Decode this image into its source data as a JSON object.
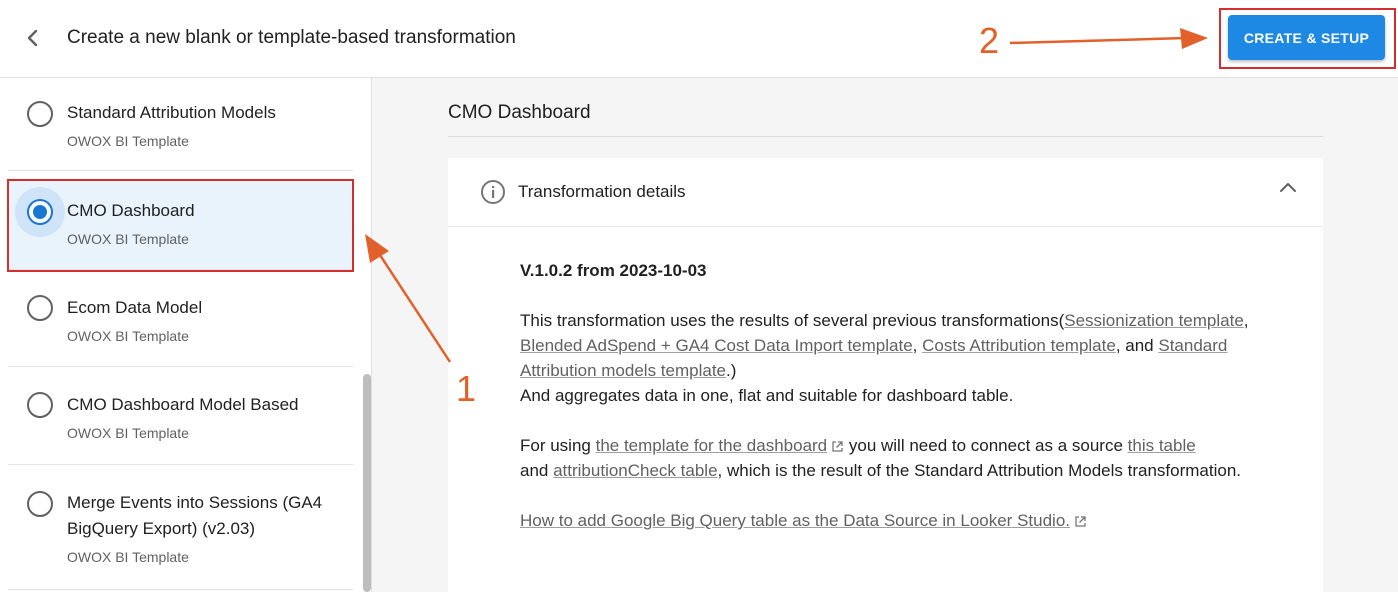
{
  "header": {
    "title": "Create a new blank or template-based transformation",
    "cta_label": "CREATE & SETUP"
  },
  "sidebar": {
    "items": [
      {
        "name": "Standard Attribution Models",
        "sub": "OWOX BI Template",
        "selected": false
      },
      {
        "name": "CMO Dashboard",
        "sub": "OWOX BI Template",
        "selected": true
      },
      {
        "name": "Ecom Data Model",
        "sub": "OWOX BI Template",
        "selected": false
      },
      {
        "name": "CMO Dashboard Model Based",
        "sub": "OWOX BI Template",
        "selected": false
      },
      {
        "name_line1": "Merge Events into Sessions (GA4",
        "name_line2": "BigQuery Export) (v2.03)",
        "sub": "OWOX BI Template",
        "selected": false
      }
    ]
  },
  "main": {
    "title": "CMO Dashboard",
    "details_title": "Transformation details",
    "version": "V.1.0.2 from 2023-10-03",
    "para1": {
      "t1": "This transformation uses the results of several previous transformations(",
      "l1": "Sessionization template",
      "t2": ", ",
      "l2": "Blended AdSpend + GA4 Cost Data Import template",
      "t3": ", ",
      "l3": "Costs Attribution template",
      "t4": ", and ",
      "l4": "Standard Attribution models template",
      "t5": ".)",
      "t6": "And aggregates data in one, flat and suitable for dashboard table."
    },
    "para2": {
      "t1": "For using ",
      "l1": "the template for the dashboard",
      "t2": "  you will need to connect as a source ",
      "l2": "this table",
      "t3": "and ",
      "l3": "attributionCheck table",
      "t4": ", which is the result of the Standard Attribution Models transformation."
    },
    "howto_link": "How to add Google Big Query table as the Data Source in Looker Studio."
  },
  "annotations": {
    "step1": "1",
    "step2": "2",
    "color": "#e2612b"
  },
  "colors": {
    "accent": "#1e88e5",
    "highlight": "#d32f2f",
    "selected_bg": "#e8f3fc"
  }
}
